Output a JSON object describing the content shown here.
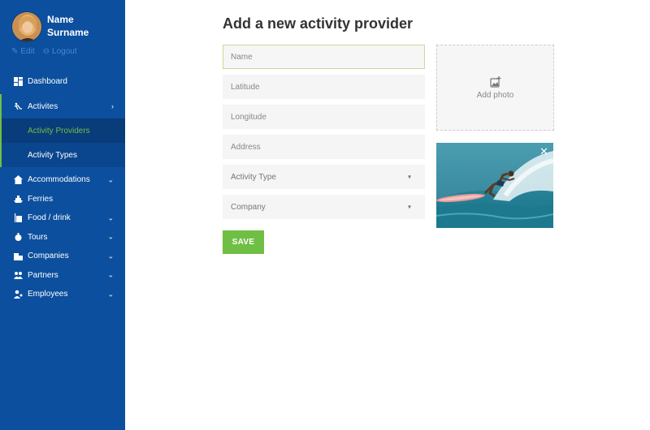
{
  "profile": {
    "name_line1": "Name",
    "name_line2": "Surname",
    "edit_label": "Edit",
    "logout_label": "Logout"
  },
  "sidebar": {
    "items": [
      {
        "label": "Dashboard",
        "icon": "dashboard-icon"
      },
      {
        "label": "Activites",
        "icon": "activities-icon"
      },
      {
        "label": "Activity Providers",
        "icon": ""
      },
      {
        "label": "Activity Types",
        "icon": ""
      },
      {
        "label": "Accommodations",
        "icon": "accommodation-icon"
      },
      {
        "label": "Ferries",
        "icon": "ferry-icon"
      },
      {
        "label": "Food / drink",
        "icon": "food-icon"
      },
      {
        "label": "Tours",
        "icon": "tours-icon"
      },
      {
        "label": "Companies",
        "icon": "companies-icon"
      },
      {
        "label": "Partners",
        "icon": "partners-icon"
      },
      {
        "label": "Employees",
        "icon": "employees-icon"
      }
    ]
  },
  "main": {
    "title": "Add a new activity provider",
    "fields": {
      "name": {
        "placeholder": "Name",
        "value": ""
      },
      "latitude": {
        "placeholder": "Latitude",
        "value": ""
      },
      "longitude": {
        "placeholder": "Longitude",
        "value": ""
      },
      "address": {
        "placeholder": "Address",
        "value": ""
      }
    },
    "selects": {
      "activity_type": "Activity Type",
      "company": "Company"
    },
    "save_label": "SAVE",
    "add_photo_label": "Add photo"
  },
  "colors": {
    "sidebar": "#0c4f9e",
    "accent_green": "#6fbf44",
    "field_bg": "#f5f5f5"
  }
}
